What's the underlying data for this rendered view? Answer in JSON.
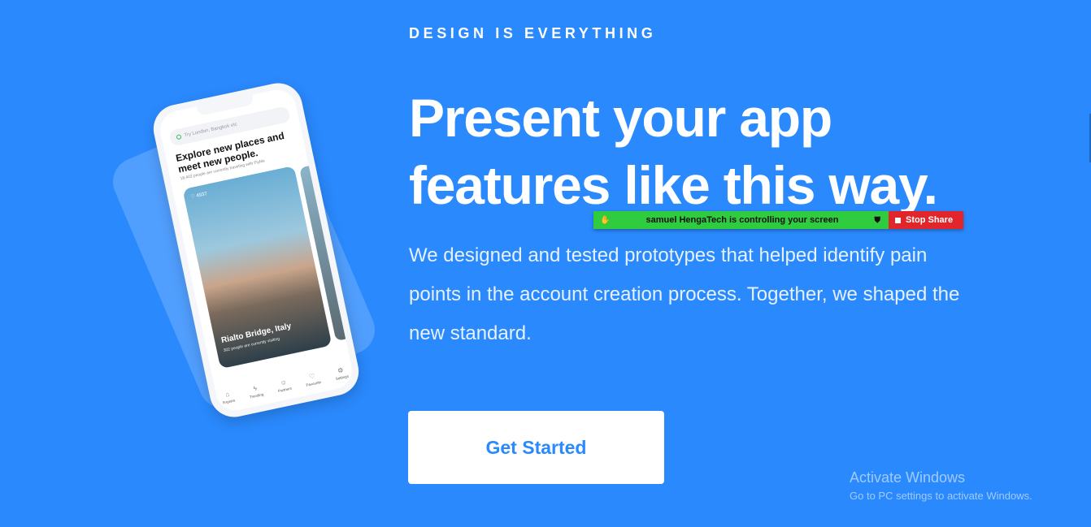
{
  "hero": {
    "eyebrow": "DESIGN IS EVERYTHING",
    "headline_line1": "Present your app",
    "headline_line2": "features like this way.",
    "body": "We designed and tested prototypes that helped identify pain points in the account creation process. Together, we shaped the new standard.",
    "cta_label": "Get Started"
  },
  "screen_share": {
    "status_text": "samuel HengaTech is controlling your screen",
    "stop_label": "Stop Share"
  },
  "phone": {
    "search_placeholder": "Try London, Bangkok etc",
    "title": "Explore new places and meet new people.",
    "subtitle": "18,402 people are currently traveling with FlyMe",
    "likes": "4937",
    "place_name": "Rialto Bridge, Italy",
    "place_sub": "302 people are currently visiting",
    "tabs": [
      {
        "label": "Explore",
        "icon": "explore-icon"
      },
      {
        "label": "Trending",
        "icon": "trending-icon"
      },
      {
        "label": "Partners",
        "icon": "partners-icon"
      },
      {
        "label": "Favourite",
        "icon": "heart-icon"
      },
      {
        "label": "Settings",
        "icon": "gear-icon"
      }
    ]
  },
  "watermark": {
    "title": "Activate Windows",
    "subtitle": "Go to PC settings to activate Windows."
  },
  "colors": {
    "background": "#2a89fd",
    "share_green": "#30cc3f",
    "share_red": "#e0262b"
  }
}
